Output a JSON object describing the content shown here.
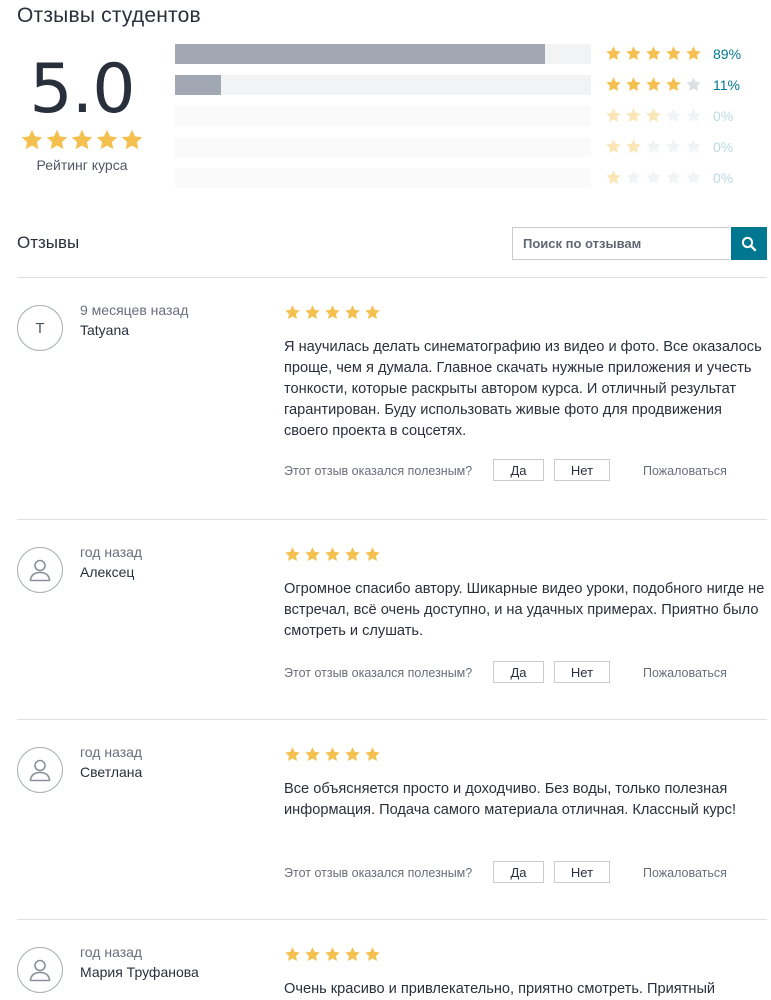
{
  "page_title": "Отзывы студентов",
  "summary": {
    "average": "5.0",
    "average_stars": 5,
    "label": "Рейтинг курса"
  },
  "distribution": [
    {
      "stars": 5,
      "percent": 89,
      "label": "89%"
    },
    {
      "stars": 4,
      "percent": 11,
      "label": "11%"
    },
    {
      "stars": 3,
      "percent": 0,
      "label": "0%"
    },
    {
      "stars": 2,
      "percent": 0,
      "label": "0%"
    },
    {
      "stars": 1,
      "percent": 0,
      "label": "0%"
    }
  ],
  "reviews_section": {
    "heading": "Отзывы",
    "search_placeholder": "Поиск по отзывам",
    "search_icon": "search-icon"
  },
  "helpful": {
    "question": "Этот отзыв оказался полезным?",
    "yes": "Да",
    "no": "Нет",
    "report": "Пожаловаться"
  },
  "reviews": [
    {
      "avatar_initial": "T",
      "time": "9 месяцев назад",
      "author": "Tatyana",
      "rating": 5,
      "text": "Я научилась делать синематографию из видео и фото. Все оказалось проще, чем я думала. Главное скачать нужные приложения и учесть тонкости, которые раскрыты автором курса. И отличный результат гарантирован. Буду использовать живые фото для продвижения своего проекта в соцсетях."
    },
    {
      "avatar_initial": "",
      "time": "год назад",
      "author": "Алексец",
      "rating": 5,
      "text": "Огромное спасибо автору. Шикарные видео уроки, подобного нигде не встречал, всё очень доступно, и на удачных примерах. Приятно было смотреть и слушать."
    },
    {
      "avatar_initial": "",
      "time": "год назад",
      "author": "Светлана",
      "rating": 5,
      "text": "Все объясняется просто и доходчиво. Без воды, только полезная информация. Подача самого материала отличная. Классный курс!"
    },
    {
      "avatar_initial": "",
      "time": "год назад",
      "author": "Мария Труфанова",
      "rating": 5,
      "text": "Очень красиво и привлекательно, приятно смотреть. Приятный"
    }
  ],
  "colors": {
    "star": "#f4c150",
    "star_empty": "#dedfe0",
    "accent": "#007791",
    "bar_fill": "#a1a7b3",
    "bar_track": "#f2f3f5"
  }
}
